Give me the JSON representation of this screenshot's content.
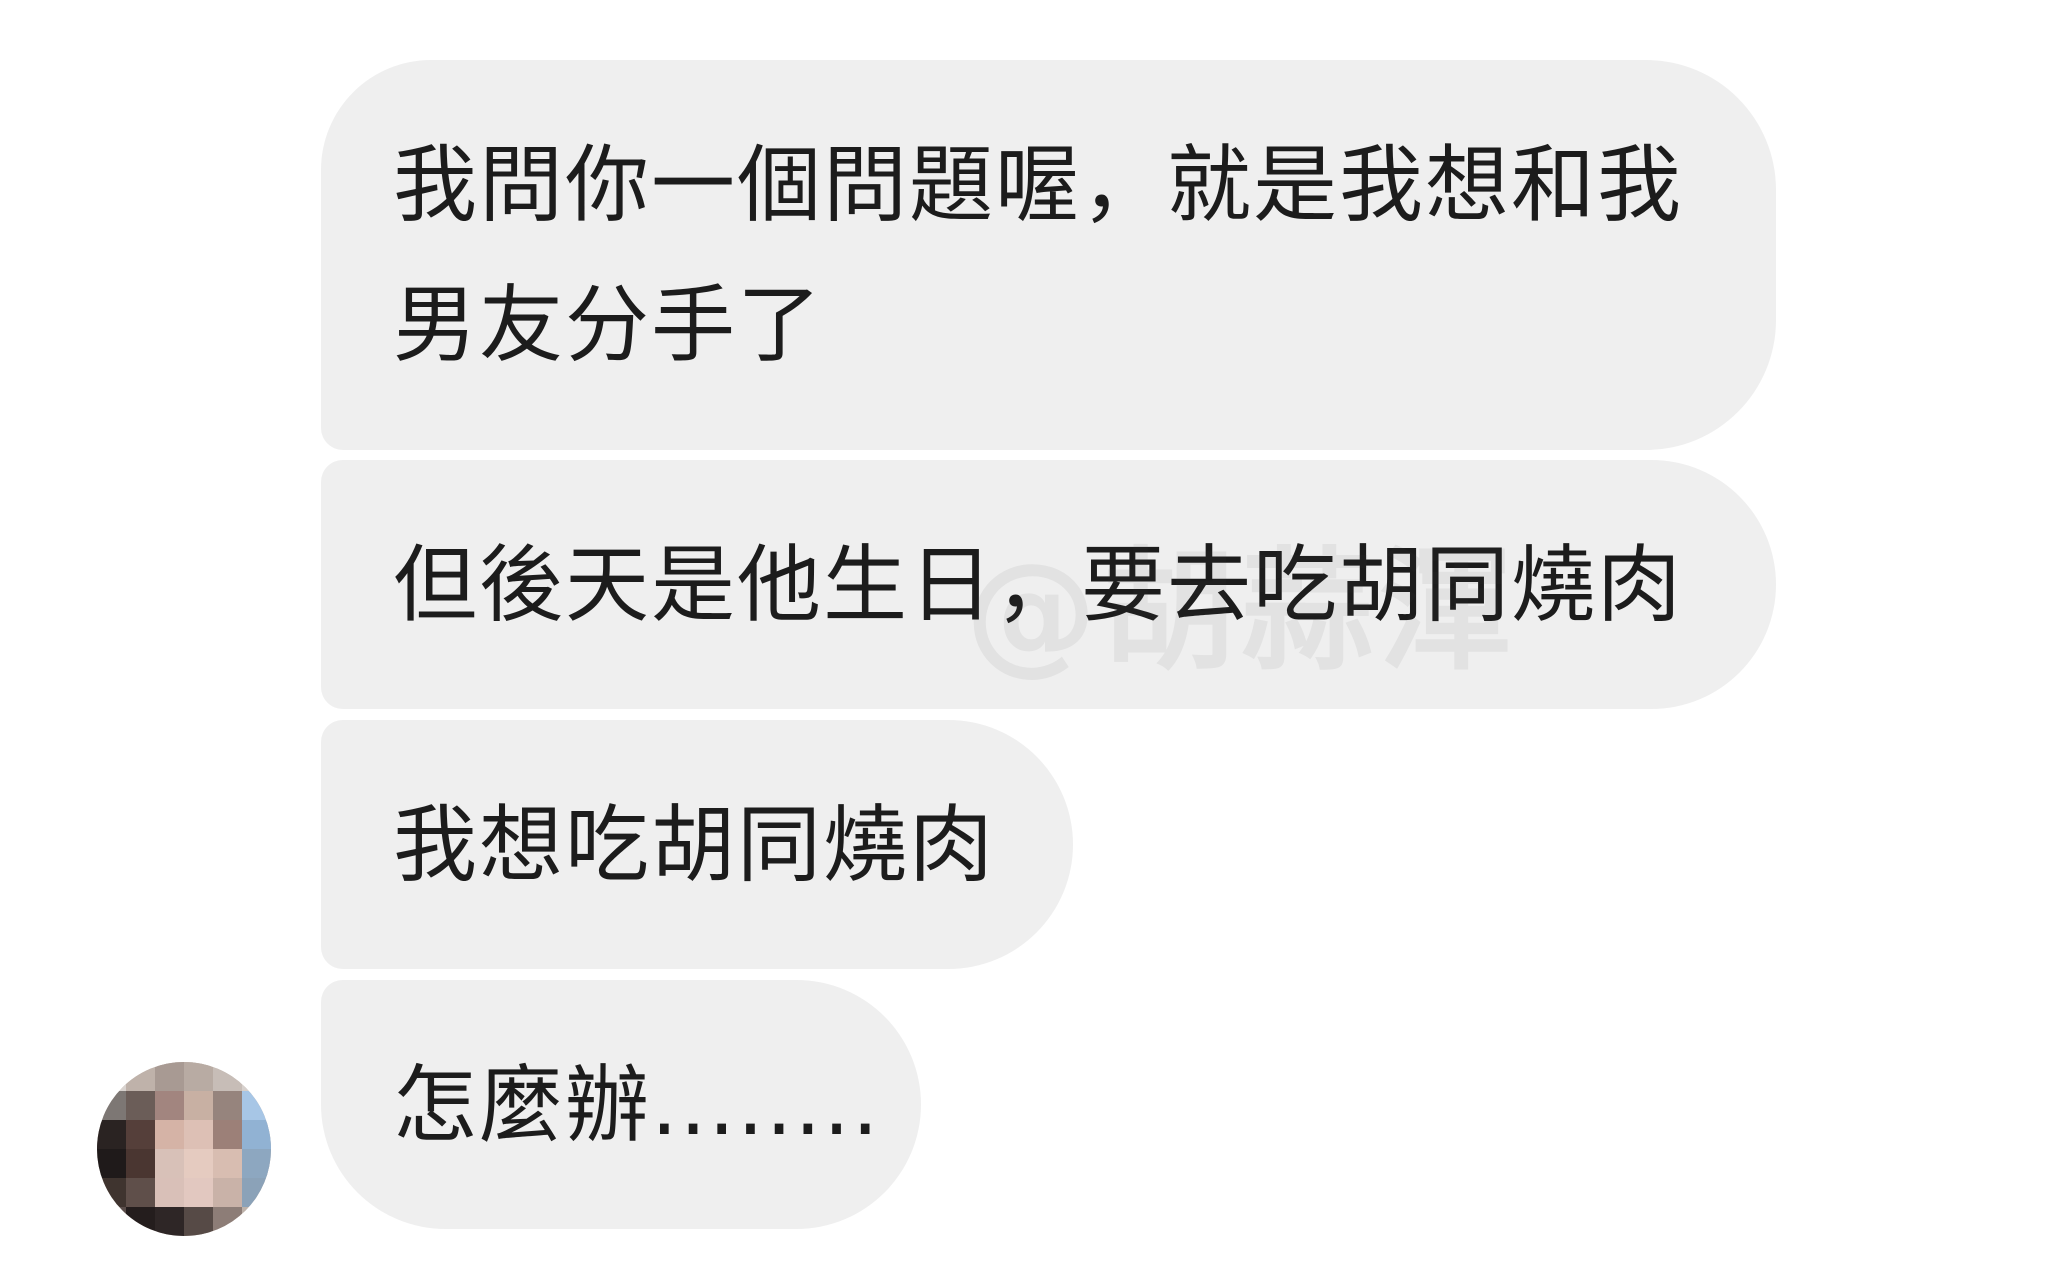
{
  "messages": [
    {
      "lines": [
        "我問你一個問題喔，就是我想和我",
        "男友分手了"
      ]
    },
    {
      "lines": [
        "但後天是他生日，要去吃胡同燒肉"
      ]
    },
    {
      "lines": [
        "我想吃胡同燒肉"
      ]
    },
    {
      "lines": [
        "怎麼辦........"
      ]
    }
  ],
  "watermark": "@胡蒜渾",
  "avatar": {
    "icon": "pixelated-avatar-icon"
  },
  "colors": {
    "background": "#ffffff",
    "bubble": "#efefef",
    "text": "#1c1c1c"
  }
}
